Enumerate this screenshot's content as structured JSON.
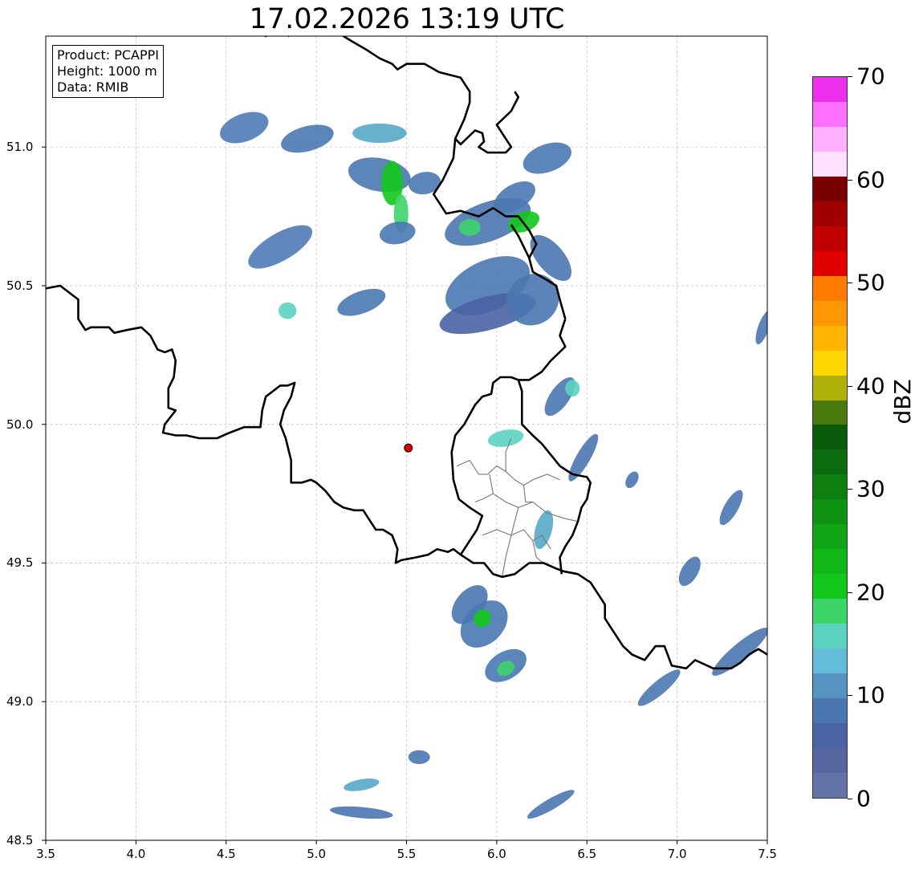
{
  "title": "17.02.2026 13:19 UTC",
  "info": {
    "product": "Product: PCAPPI",
    "height": "Height: 1000 m",
    "data": "Data: RMIB"
  },
  "chart_data": {
    "type": "map",
    "xlim": [
      3.5,
      7.5
    ],
    "ylim": [
      48.5,
      51.4
    ],
    "x_ticks": [
      "3.5",
      "4.0",
      "4.5",
      "5.0",
      "5.5",
      "6.0",
      "6.5",
      "7.0",
      "7.5"
    ],
    "y_ticks": [
      "48.5",
      "49.0",
      "49.5",
      "50.0",
      "50.5",
      "51.0"
    ],
    "grid": true,
    "radar_site": {
      "lon": 5.51,
      "lat": 49.915,
      "color": "#e00000"
    },
    "colorbar": {
      "label": "dBZ",
      "min": 0,
      "max": 70,
      "ticks": [
        "0",
        "10",
        "20",
        "30",
        "40",
        "50",
        "60",
        "70"
      ],
      "levels": [
        "#6274a6",
        "#5566a0",
        "#4a63a3",
        "#4b77b0",
        "#5594c0",
        "#63bcd8",
        "#5cd3c0",
        "#3dd46a",
        "#12c81b",
        "#10b817",
        "#0fa515",
        "#0d9212",
        "#0c7f10",
        "#0a6c0e",
        "#095a0b",
        "#4a7a0d",
        "#b0b00a",
        "#ffd700",
        "#ffb400",
        "#ff9800",
        "#ff7c00",
        "#e00000",
        "#c00000",
        "#a00000",
        "#7a0000",
        "#ffe0ff",
        "#ffb0ff",
        "#ff70ff",
        "#ee30ee"
      ]
    },
    "echoes": [
      {
        "lon": 4.6,
        "lat": 51.07,
        "w": 0.28,
        "h": 0.1,
        "a": -20,
        "c": "#4f7bb5"
      },
      {
        "lon": 4.95,
        "lat": 51.03,
        "w": 0.3,
        "h": 0.09,
        "a": -15,
        "c": "#4a78b2"
      },
      {
        "lon": 5.35,
        "lat": 51.05,
        "w": 0.3,
        "h": 0.07,
        "a": 0,
        "c": "#56a8c8"
      },
      {
        "lon": 5.35,
        "lat": 50.9,
        "w": 0.35,
        "h": 0.12,
        "a": 10,
        "c": "#4a78b2"
      },
      {
        "lon": 5.42,
        "lat": 50.87,
        "w": 0.12,
        "h": 0.16,
        "a": 0,
        "c": "#12c81b"
      },
      {
        "lon": 5.47,
        "lat": 50.76,
        "w": 0.08,
        "h": 0.14,
        "a": 0,
        "c": "#3dd46a"
      },
      {
        "lon": 5.6,
        "lat": 50.87,
        "w": 0.18,
        "h": 0.08,
        "a": -10,
        "c": "#4a78b2"
      },
      {
        "lon": 5.45,
        "lat": 50.69,
        "w": 0.2,
        "h": 0.08,
        "a": -10,
        "c": "#4a78b2"
      },
      {
        "lon": 4.8,
        "lat": 50.64,
        "w": 0.4,
        "h": 0.1,
        "a": -30,
        "c": "#4f7bb5"
      },
      {
        "lon": 4.84,
        "lat": 50.41,
        "w": 0.1,
        "h": 0.06,
        "a": 0,
        "c": "#5cd3c0"
      },
      {
        "lon": 5.25,
        "lat": 50.44,
        "w": 0.28,
        "h": 0.08,
        "a": -20,
        "c": "#4a78b2"
      },
      {
        "lon": 6.28,
        "lat": 50.96,
        "w": 0.28,
        "h": 0.1,
        "a": -20,
        "c": "#4a78b2"
      },
      {
        "lon": 6.1,
        "lat": 50.82,
        "w": 0.25,
        "h": 0.09,
        "a": -30,
        "c": "#4a78b2"
      },
      {
        "lon": 5.95,
        "lat": 50.73,
        "w": 0.5,
        "h": 0.14,
        "a": -20,
        "c": "#4b77b0"
      },
      {
        "lon": 6.15,
        "lat": 50.73,
        "w": 0.18,
        "h": 0.07,
        "a": -20,
        "c": "#12c81b"
      },
      {
        "lon": 5.85,
        "lat": 50.71,
        "w": 0.12,
        "h": 0.06,
        "a": 0,
        "c": "#3dd46a"
      },
      {
        "lon": 5.95,
        "lat": 50.5,
        "w": 0.5,
        "h": 0.18,
        "a": -25,
        "c": "#4a78b2"
      },
      {
        "lon": 5.95,
        "lat": 50.4,
        "w": 0.55,
        "h": 0.12,
        "a": -15,
        "c": "#4a63a3"
      },
      {
        "lon": 6.2,
        "lat": 50.45,
        "w": 0.3,
        "h": 0.18,
        "a": -40,
        "c": "#4b77b0"
      },
      {
        "lon": 6.3,
        "lat": 50.6,
        "w": 0.15,
        "h": 0.2,
        "a": -40,
        "c": "#4b77b0"
      },
      {
        "lon": 6.35,
        "lat": 50.1,
        "w": 0.25,
        "h": 0.07,
        "a": -55,
        "c": "#4b77b0"
      },
      {
        "lon": 6.42,
        "lat": 50.13,
        "w": 0.08,
        "h": 0.06,
        "a": 0,
        "c": "#5cd3c0"
      },
      {
        "lon": 6.05,
        "lat": 49.95,
        "w": 0.2,
        "h": 0.06,
        "a": -10,
        "c": "#5cd3c0"
      },
      {
        "lon": 6.48,
        "lat": 49.88,
        "w": 0.3,
        "h": 0.05,
        "a": -60,
        "c": "#4b77b0"
      },
      {
        "lon": 6.26,
        "lat": 49.62,
        "w": 0.22,
        "h": 0.06,
        "a": -75,
        "c": "#56a8c8"
      },
      {
        "lon": 5.85,
        "lat": 49.35,
        "w": 0.25,
        "h": 0.1,
        "a": -50,
        "c": "#4b77b0"
      },
      {
        "lon": 5.93,
        "lat": 49.28,
        "w": 0.3,
        "h": 0.14,
        "a": -45,
        "c": "#4a78b2"
      },
      {
        "lon": 5.92,
        "lat": 49.3,
        "w": 0.1,
        "h": 0.06,
        "a": -45,
        "c": "#12c81b"
      },
      {
        "lon": 6.05,
        "lat": 49.13,
        "w": 0.25,
        "h": 0.1,
        "a": -30,
        "c": "#4a78b2"
      },
      {
        "lon": 6.05,
        "lat": 49.12,
        "w": 0.1,
        "h": 0.05,
        "a": -30,
        "c": "#3dd46a"
      },
      {
        "lon": 6.75,
        "lat": 49.8,
        "w": 0.1,
        "h": 0.04,
        "a": -60,
        "c": "#4b77b0"
      },
      {
        "lon": 7.3,
        "lat": 49.7,
        "w": 0.22,
        "h": 0.05,
        "a": -60,
        "c": "#4b77b0"
      },
      {
        "lon": 7.07,
        "lat": 49.47,
        "w": 0.18,
        "h": 0.06,
        "a": -60,
        "c": "#4b77b0"
      },
      {
        "lon": 7.48,
        "lat": 50.35,
        "w": 0.2,
        "h": 0.04,
        "a": -70,
        "c": "#4b77b0"
      },
      {
        "lon": 7.35,
        "lat": 49.18,
        "w": 0.4,
        "h": 0.06,
        "a": -40,
        "c": "#4b77b0"
      },
      {
        "lon": 6.9,
        "lat": 49.05,
        "w": 0.3,
        "h": 0.05,
        "a": -40,
        "c": "#4a78b2"
      },
      {
        "lon": 5.57,
        "lat": 48.8,
        "w": 0.12,
        "h": 0.05,
        "a": 0,
        "c": "#4b77b0"
      },
      {
        "lon": 5.25,
        "lat": 48.7,
        "w": 0.2,
        "h": 0.04,
        "a": -10,
        "c": "#56a8c8"
      },
      {
        "lon": 5.25,
        "lat": 48.6,
        "w": 0.35,
        "h": 0.04,
        "a": 5,
        "c": "#4b77b0"
      },
      {
        "lon": 6.3,
        "lat": 48.63,
        "w": 0.3,
        "h": 0.04,
        "a": -30,
        "c": "#4b77b0"
      }
    ],
    "borders": [
      [
        [
          3.5,
          50.49
        ],
        [
          3.58,
          50.5
        ],
        [
          3.62,
          50.48
        ],
        [
          3.68,
          50.45
        ],
        [
          3.68,
          50.38
        ],
        [
          3.72,
          50.34
        ],
        [
          3.75,
          50.35
        ],
        [
          3.85,
          50.35
        ],
        [
          3.88,
          50.33
        ],
        [
          3.95,
          50.34
        ],
        [
          4.03,
          50.35
        ],
        [
          4.08,
          50.32
        ],
        [
          4.12,
          50.27
        ],
        [
          4.16,
          50.26
        ],
        [
          4.2,
          50.27
        ],
        [
          4.22,
          50.23
        ],
        [
          4.21,
          50.17
        ],
        [
          4.18,
          50.13
        ],
        [
          4.18,
          50.06
        ],
        [
          4.22,
          50.05
        ],
        [
          4.16,
          50.0
        ],
        [
          4.15,
          49.97
        ],
        [
          4.22,
          49.96
        ],
        [
          4.28,
          49.96
        ],
        [
          4.35,
          49.95
        ],
        [
          4.45,
          49.95
        ],
        [
          4.52,
          49.97
        ],
        [
          4.6,
          49.99
        ],
        [
          4.69,
          49.99
        ],
        [
          4.7,
          50.05
        ],
        [
          4.72,
          50.1
        ],
        [
          4.8,
          50.14
        ],
        [
          4.84,
          50.14
        ],
        [
          4.88,
          50.15
        ],
        [
          4.86,
          50.1
        ],
        [
          4.82,
          50.05
        ],
        [
          4.8,
          50.0
        ],
        [
          4.83,
          49.95
        ],
        [
          4.86,
          49.87
        ],
        [
          4.86,
          49.79
        ],
        [
          4.92,
          49.79
        ],
        [
          4.97,
          49.8
        ],
        [
          5.0,
          49.79
        ],
        [
          5.05,
          49.76
        ],
        [
          5.1,
          49.72
        ],
        [
          5.15,
          49.7
        ],
        [
          5.21,
          49.69
        ],
        [
          5.26,
          49.69
        ],
        [
          5.3,
          49.65
        ],
        [
          5.33,
          49.62
        ],
        [
          5.37,
          49.62
        ],
        [
          5.42,
          49.6
        ],
        [
          5.45,
          49.55
        ],
        [
          5.44,
          49.5
        ],
        [
          5.47,
          49.51
        ],
        [
          5.55,
          49.52
        ],
        [
          5.62,
          49.53
        ],
        [
          5.67,
          49.55
        ],
        [
          5.73,
          49.54
        ],
        [
          5.76,
          49.55
        ],
        [
          5.8,
          49.53
        ],
        [
          5.87,
          49.5
        ],
        [
          5.93,
          49.5
        ],
        [
          5.98,
          49.46
        ],
        [
          6.03,
          49.45
        ],
        [
          6.1,
          49.46
        ],
        [
          6.18,
          49.5
        ],
        [
          6.26,
          49.5
        ],
        [
          6.33,
          49.48
        ],
        [
          6.37,
          49.47
        ],
        [
          6.45,
          49.46
        ],
        [
          6.52,
          49.43
        ],
        [
          6.57,
          49.38
        ],
        [
          6.6,
          49.35
        ],
        [
          6.6,
          49.3
        ],
        [
          6.65,
          49.25
        ],
        [
          6.7,
          49.2
        ],
        [
          6.75,
          49.17
        ],
        [
          6.82,
          49.15
        ],
        [
          6.88,
          49.2
        ],
        [
          6.93,
          49.2
        ],
        [
          6.97,
          49.13
        ],
        [
          7.05,
          49.12
        ],
        [
          7.1,
          49.15
        ],
        [
          7.2,
          49.12
        ],
        [
          7.3,
          49.12
        ],
        [
          7.35,
          49.14
        ],
        [
          7.4,
          49.17
        ],
        [
          7.45,
          49.19
        ],
        [
          7.5,
          49.17
        ]
      ],
      [
        [
          6.38,
          50.38
        ],
        [
          6.35,
          50.32
        ],
        [
          6.38,
          50.28
        ],
        [
          6.3,
          50.23
        ],
        [
          6.25,
          50.19
        ],
        [
          6.18,
          50.16
        ],
        [
          6.12,
          50.16
        ],
        [
          6.08,
          50.17
        ],
        [
          6.02,
          50.17
        ],
        [
          5.98,
          50.15
        ],
        [
          5.97,
          50.11
        ],
        [
          5.92,
          50.1
        ],
        [
          5.88,
          50.07
        ],
        [
          5.82,
          50.0
        ],
        [
          5.77,
          49.96
        ],
        [
          5.75,
          49.9
        ],
        [
          5.76,
          49.8
        ],
        [
          5.79,
          49.73
        ],
        [
          5.85,
          49.7
        ],
        [
          5.92,
          49.67
        ],
        [
          5.89,
          49.62
        ],
        [
          5.82,
          49.55
        ],
        [
          5.8,
          49.53
        ]
      ],
      [
        [
          6.12,
          50.16
        ],
        [
          6.14,
          50.12
        ],
        [
          6.14,
          50.05
        ],
        [
          6.14,
          50.0
        ],
        [
          6.2,
          49.96
        ],
        [
          6.25,
          49.93
        ],
        [
          6.3,
          49.89
        ],
        [
          6.35,
          49.85
        ],
        [
          6.42,
          49.82
        ],
        [
          6.5,
          49.81
        ],
        [
          6.52,
          49.79
        ],
        [
          6.5,
          49.73
        ],
        [
          6.47,
          49.7
        ],
        [
          6.45,
          49.65
        ],
        [
          6.42,
          49.6
        ],
        [
          6.38,
          49.56
        ],
        [
          6.35,
          49.52
        ],
        [
          6.36,
          49.46
        ]
      ],
      [
        [
          6.38,
          50.38
        ],
        [
          6.35,
          50.45
        ],
        [
          6.33,
          50.5
        ],
        [
          6.28,
          50.52
        ],
        [
          6.2,
          50.55
        ],
        [
          6.18,
          50.6
        ],
        [
          6.22,
          50.65
        ],
        [
          6.18,
          50.7
        ],
        [
          6.12,
          50.75
        ],
        [
          6.05,
          50.75
        ],
        [
          5.98,
          50.78
        ],
        [
          5.9,
          50.75
        ],
        [
          5.8,
          50.77
        ],
        [
          5.72,
          50.76
        ],
        [
          5.68,
          50.8
        ],
        [
          5.65,
          50.83
        ],
        [
          5.7,
          50.88
        ],
        [
          5.76,
          50.96
        ],
        [
          5.77,
          51.03
        ],
        [
          5.82,
          51.1
        ],
        [
          5.85,
          51.16
        ],
        [
          5.85,
          51.2
        ],
        [
          5.8,
          51.25
        ],
        [
          5.68,
          51.27
        ],
        [
          5.6,
          51.3
        ],
        [
          5.5,
          51.3
        ],
        [
          5.45,
          51.28
        ],
        [
          5.42,
          51.3
        ],
        [
          5.35,
          51.32
        ],
        [
          5.28,
          51.35
        ],
        [
          5.2,
          51.38
        ],
        [
          5.1,
          51.42
        ]
      ],
      [
        [
          4.85,
          51.4
        ],
        [
          4.78,
          51.42
        ],
        [
          4.72,
          51.4
        ],
        [
          4.68,
          51.42
        ],
        [
          4.6,
          51.44
        ]
      ],
      [
        [
          6.18,
          50.6
        ],
        [
          6.12,
          50.68
        ],
        [
          6.08,
          50.72
        ]
      ],
      [
        [
          5.77,
          51.03
        ],
        [
          5.8,
          51.01
        ],
        [
          5.88,
          51.06
        ],
        [
          5.92,
          51.05
        ],
        [
          5.93,
          51.02
        ],
        [
          5.9,
          51.0
        ],
        [
          5.95,
          50.98
        ],
        [
          6.05,
          50.98
        ],
        [
          6.08,
          51.0
        ],
        [
          6.0,
          51.08
        ],
        [
          6.08,
          51.13
        ],
        [
          6.12,
          51.18
        ],
        [
          6.1,
          51.2
        ]
      ]
    ],
    "subregions": [
      [
        [
          5.78,
          49.85
        ],
        [
          5.85,
          49.87
        ],
        [
          5.9,
          49.82
        ],
        [
          5.95,
          49.82
        ],
        [
          6.0,
          49.85
        ],
        [
          6.05,
          49.83
        ],
        [
          6.1,
          49.8
        ],
        [
          6.15,
          49.78
        ],
        [
          6.2,
          49.8
        ],
        [
          6.28,
          49.82
        ],
        [
          6.35,
          49.8
        ]
      ],
      [
        [
          5.88,
          49.72
        ],
        [
          5.92,
          49.73
        ],
        [
          5.98,
          49.75
        ],
        [
          6.05,
          49.72
        ],
        [
          6.12,
          49.7
        ],
        [
          6.2,
          49.72
        ],
        [
          6.28,
          49.68
        ],
        [
          6.38,
          49.66
        ],
        [
          6.45,
          49.65
        ]
      ],
      [
        [
          5.92,
          49.6
        ],
        [
          6.0,
          49.62
        ],
        [
          6.08,
          49.6
        ],
        [
          6.15,
          49.62
        ],
        [
          6.2,
          49.58
        ],
        [
          6.25,
          49.6
        ],
        [
          6.3,
          49.55
        ]
      ],
      [
        [
          6.08,
          49.95
        ],
        [
          6.05,
          49.9
        ],
        [
          6.05,
          49.83
        ]
      ],
      [
        [
          6.15,
          49.78
        ],
        [
          6.16,
          49.72
        ],
        [
          6.2,
          49.72
        ]
      ],
      [
        [
          6.12,
          49.7
        ],
        [
          6.1,
          49.65
        ],
        [
          6.08,
          49.6
        ],
        [
          6.05,
          49.52
        ],
        [
          6.03,
          49.45
        ]
      ],
      [
        [
          5.98,
          49.75
        ],
        [
          5.96,
          49.82
        ]
      ],
      [
        [
          6.2,
          49.58
        ],
        [
          6.22,
          49.52
        ],
        [
          6.26,
          49.5
        ]
      ]
    ]
  }
}
